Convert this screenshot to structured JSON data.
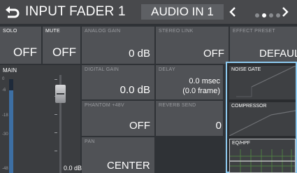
{
  "header": {
    "title": "INPUT FADER 1",
    "channel": "AUDIO IN 1",
    "prev_icon": "chevron-left-icon",
    "next_icon": "chevron-right-icon",
    "back_icon": "return-arrow-icon",
    "pages": [
      false,
      true,
      false,
      false
    ]
  },
  "solo": {
    "label": "SOLO",
    "value": "OFF"
  },
  "mute": {
    "label": "MUTE",
    "value": "OFF"
  },
  "analog_gain": {
    "label": "ANALOG GAIN",
    "value": "0 dB"
  },
  "stereo_link": {
    "label": "STEREO LINK",
    "value": "OFF"
  },
  "effect_preset": {
    "label": "EFFECT PRESET",
    "value": "DEFAULT"
  },
  "main": {
    "label": "MAIN",
    "fader_value": "0.0 dB",
    "meter_level": 0.88
  },
  "digital_gain": {
    "label": "DIGITAL GAIN",
    "value": "0.0 dB"
  },
  "delay": {
    "label": "DELAY",
    "value": "0.0 msec",
    "frames": "(0.0 frame)"
  },
  "phantom": {
    "label": "PHANTOM +48V",
    "value": "OFF"
  },
  "reverb_send": {
    "label": "REVERB SEND",
    "value": "0"
  },
  "pan": {
    "label": "PAN",
    "value": "CENTER"
  },
  "dynamics": {
    "noise_gate": "NOISE GATE",
    "compressor": "COMPRESSOR",
    "eq_hpf": "EQ/HPF"
  },
  "colors": {
    "accent": "#8ecbf1",
    "meter": "#3d6fa3",
    "cell": "#505256"
  }
}
